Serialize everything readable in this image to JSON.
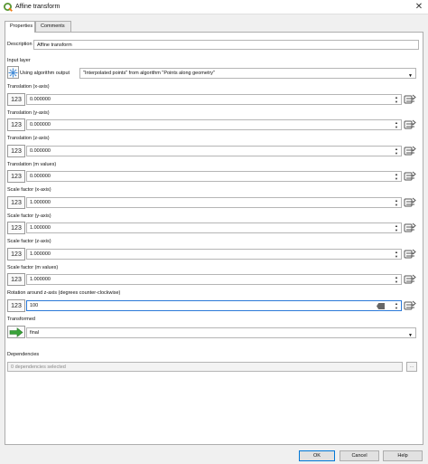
{
  "window": {
    "title": "Affine transform"
  },
  "tabs": [
    {
      "label": "Properties"
    },
    {
      "label": "Comments"
    }
  ],
  "description": {
    "label": "Description",
    "value": "Affine transform"
  },
  "input_layer": {
    "label": "Input layer",
    "mode_text": "Using algorithm output",
    "selected": "\"Interpolated points\" from algorithm \"Points along geometry\""
  },
  "params": [
    {
      "label": "Translation (x-axis)",
      "value": "0.000000"
    },
    {
      "label": "Translation (y-axis)",
      "value": "0.000000"
    },
    {
      "label": "Translation (z-axis)",
      "value": "0.000000"
    },
    {
      "label": "Translation (m values)",
      "value": "0.000000"
    },
    {
      "label": "Scale factor (x-axis)",
      "value": "1.000000"
    },
    {
      "label": "Scale factor (y-axis)",
      "value": "1.000000"
    },
    {
      "label": "Scale factor (z-axis)",
      "value": "1.000000"
    },
    {
      "label": "Scale factor (m values)",
      "value": "1.000000"
    },
    {
      "label": "Rotation around z-axis (degrees counter-clockwise)",
      "value": "100"
    }
  ],
  "numeric_icon_text": "123",
  "transformed": {
    "label": "Transformed",
    "value": "final"
  },
  "dependencies": {
    "label": "Dependencies",
    "value": "0 dependencies selected",
    "button": "..."
  },
  "buttons": {
    "ok": "OK",
    "cancel": "Cancel",
    "help": "Help"
  },
  "colors": {
    "accent": "#2b79d8",
    "qgis_green": "#589632",
    "arrow_green": "#3aa33a"
  }
}
